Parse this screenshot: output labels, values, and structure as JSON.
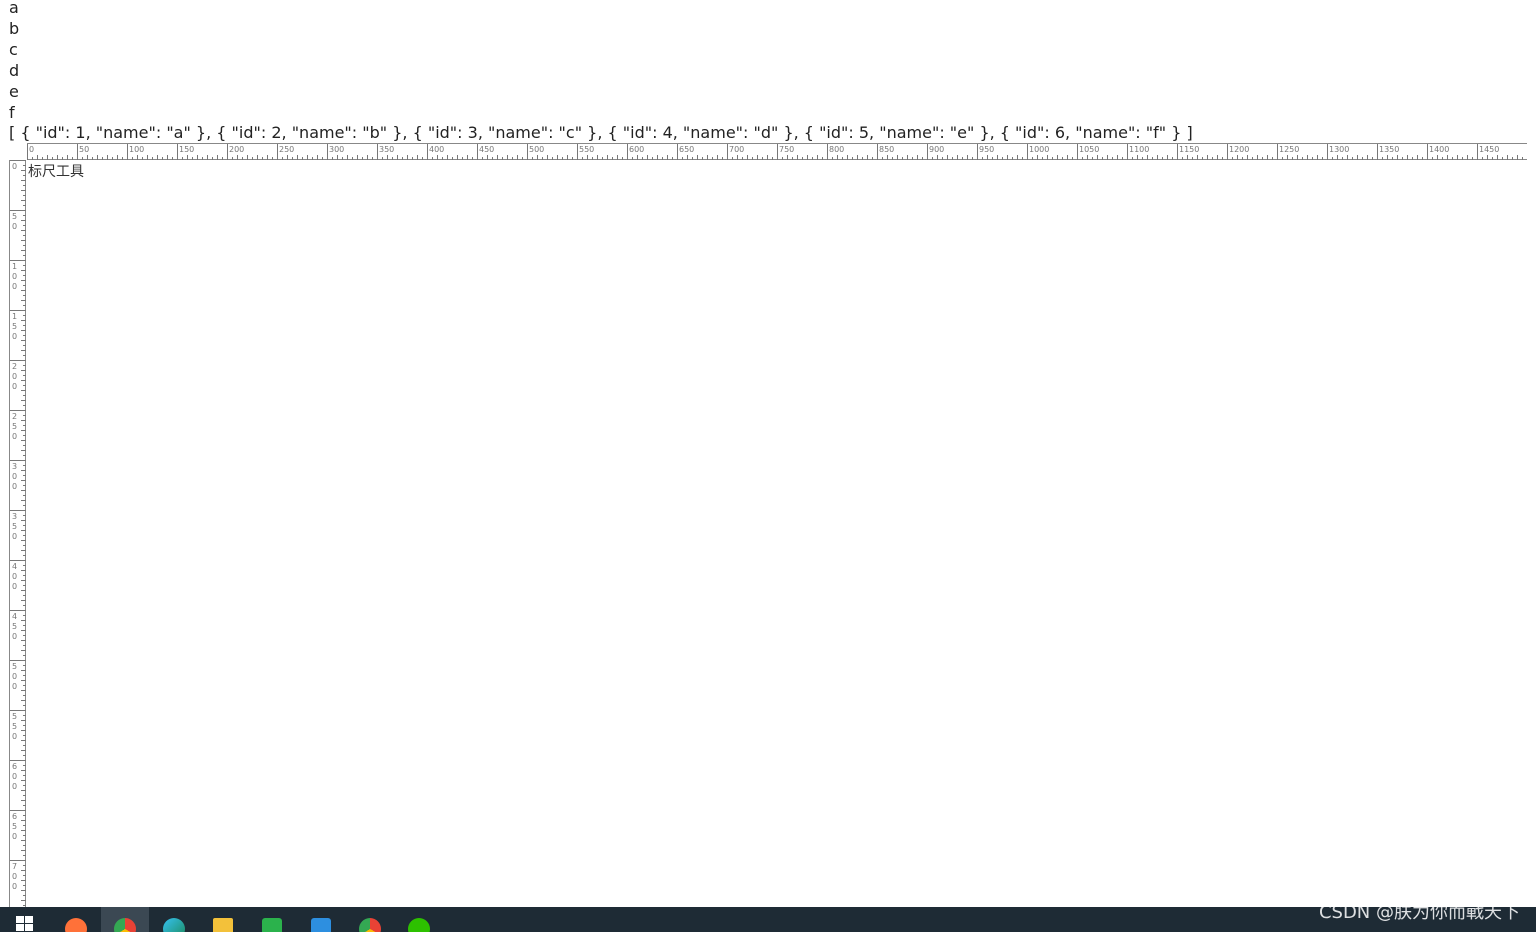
{
  "list_items": [
    "a",
    "b",
    "c",
    "d",
    "e",
    "f"
  ],
  "json_text": "[ { \"id\": 1, \"name\": \"a\" }, { \"id\": 2, \"name\": \"b\" }, { \"id\": 3, \"name\": \"c\" }, { \"id\": 4, \"name\": \"d\" }, { \"id\": 5, \"name\": \"e\" }, { \"id\": 6, \"name\": \"f\" } ]",
  "ruler": {
    "horizontal_labels": [
      "0",
      "50",
      "100",
      "150",
      "200",
      "250",
      "300",
      "350",
      "400",
      "450",
      "500",
      "550",
      "600",
      "650",
      "700",
      "750",
      "800",
      "850",
      "900",
      "950",
      "1000",
      "1050",
      "1100",
      "1150",
      "1200",
      "1250",
      "1300",
      "1350",
      "1400",
      "1450"
    ],
    "vertical_labels": [
      "0",
      "50",
      "100",
      "150",
      "200",
      "250",
      "300",
      "350",
      "400",
      "450",
      "500",
      "550",
      "600",
      "650",
      "700"
    ]
  },
  "tool_label": "标尺工具",
  "taskbar": {
    "icons": [
      {
        "name": "start-icon"
      },
      {
        "name": "firefox-icon",
        "color": "#ff7139"
      },
      {
        "name": "chrome-icon",
        "color": "#e94235",
        "active": true
      },
      {
        "name": "edge-icon",
        "color": "#1fa0e0"
      },
      {
        "name": "file-explorer-icon",
        "color": "#f3c13a"
      },
      {
        "name": "hbuilder-icon",
        "color": "#2bb24c"
      },
      {
        "name": "vscode-icon",
        "color": "#2d8fe0"
      },
      {
        "name": "chrome-icon-2",
        "color": "#e94235"
      },
      {
        "name": "wechat-icon",
        "color": "#2dc100"
      }
    ]
  },
  "watermark": "CSDN @朕为你而戰天下"
}
